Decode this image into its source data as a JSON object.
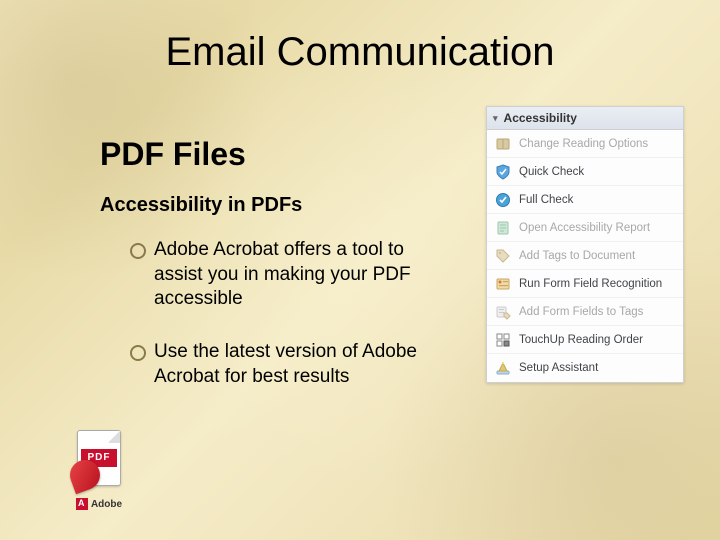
{
  "slide": {
    "title": "Email Communication",
    "section": "PDF Files",
    "subtitle": "Accessibility in PDFs",
    "bullets": [
      "Adobe Acrobat offers a tool to assist you in making your PDF accessible",
      "Use the latest version of Adobe Acrobat for best results"
    ]
  },
  "pdf_logo": {
    "band": "PDF",
    "vendor": "Adobe"
  },
  "panel": {
    "title": "Accessibility",
    "items": [
      {
        "label": "Change Reading Options",
        "enabled": false,
        "icon": "book-icon"
      },
      {
        "label": "Quick Check",
        "enabled": true,
        "icon": "check-shield-icon"
      },
      {
        "label": "Full Check",
        "enabled": true,
        "icon": "check-circle-icon"
      },
      {
        "label": "Open Accessibility Report",
        "enabled": false,
        "icon": "report-icon"
      },
      {
        "label": "Add Tags to Document",
        "enabled": false,
        "icon": "tag-icon"
      },
      {
        "label": "Run Form Field Recognition",
        "enabled": true,
        "icon": "form-icon"
      },
      {
        "label": "Add Form Fields to Tags",
        "enabled": false,
        "icon": "form-tag-icon"
      },
      {
        "label": "TouchUp Reading Order",
        "enabled": true,
        "icon": "grid-icon"
      },
      {
        "label": "Setup Assistant",
        "enabled": true,
        "icon": "wizard-icon"
      }
    ]
  }
}
